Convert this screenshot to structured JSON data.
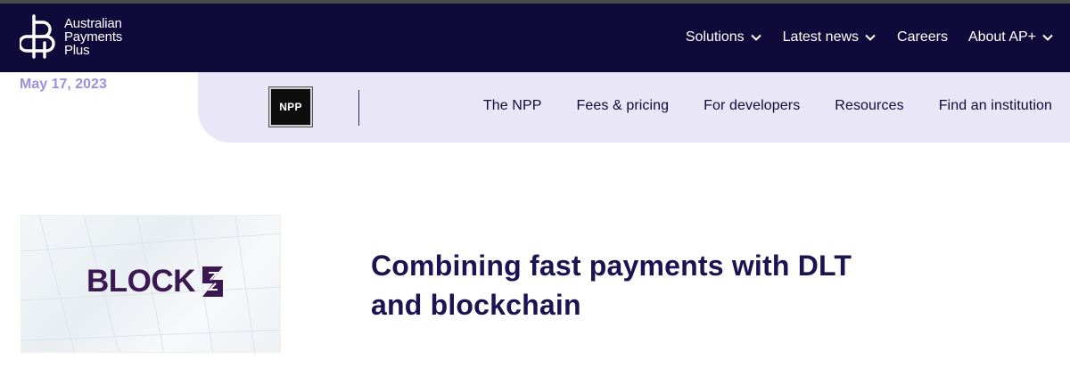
{
  "brand": {
    "name_lines": [
      "Australian",
      "Payments",
      "Plus"
    ]
  },
  "main_nav": {
    "items": [
      {
        "label": "Solutions",
        "has_dropdown": true
      },
      {
        "label": "Latest news",
        "has_dropdown": true
      },
      {
        "label": "Careers",
        "has_dropdown": false
      },
      {
        "label": "About AP+",
        "has_dropdown": true
      }
    ]
  },
  "date": "May 17, 2023",
  "sub_nav": {
    "logo_text": "NPP",
    "items": [
      {
        "label": "The NPP"
      },
      {
        "label": "Fees & pricing"
      },
      {
        "label": "For developers"
      },
      {
        "label": "Resources"
      },
      {
        "label": "Find an institution"
      }
    ]
  },
  "article": {
    "image_logo_text": "BLOCK",
    "title_lines": [
      "Combining fast payments with DLT",
      "and blockchain"
    ]
  },
  "colors": {
    "header_bg": "#0f0a3a",
    "subnav_bg": "#e9e6f8",
    "date_text": "#9c8fe0",
    "title_text": "#1a1552",
    "block_logo": "#3b1851"
  },
  "icons": {
    "brand": "ap-plus-logo-icon",
    "dropdown": "chevron-down-icon",
    "block_mark": "block-z-mark-icon"
  }
}
